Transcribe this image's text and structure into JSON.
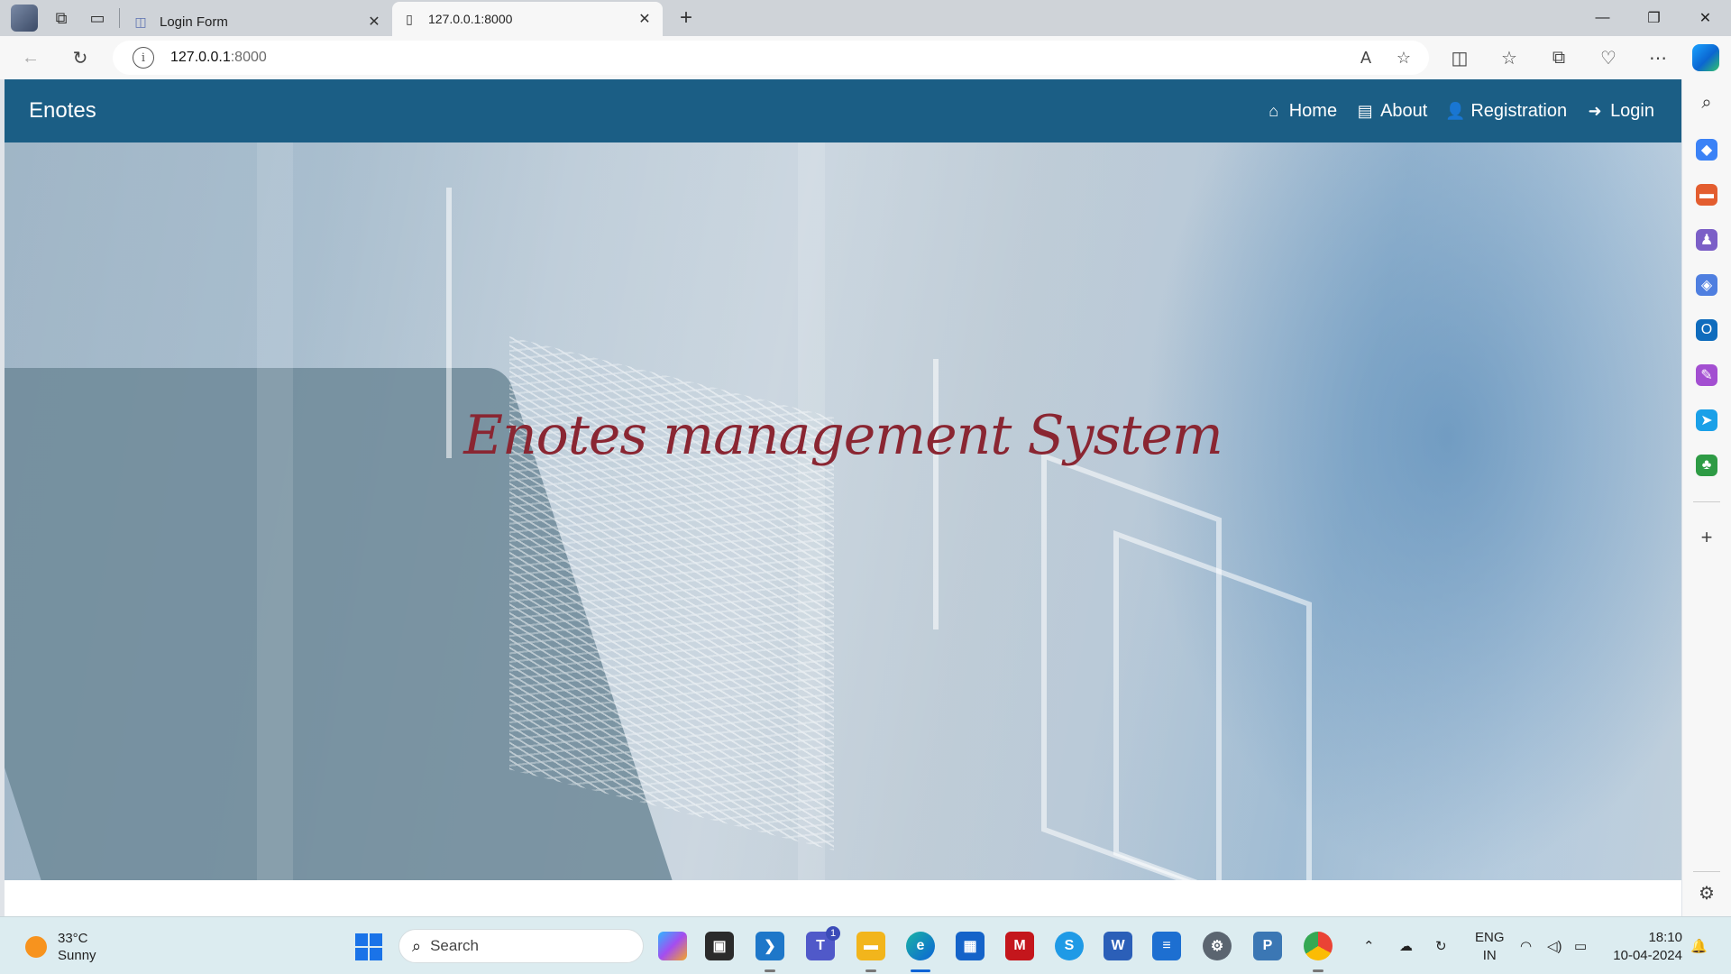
{
  "browser": {
    "tabs": [
      {
        "title": "Login Form",
        "active": false
      },
      {
        "title": "127.0.0.1:8000",
        "active": true
      }
    ],
    "address": {
      "host": "127.0.0.1",
      "port": ":8000"
    }
  },
  "site": {
    "brand": "Enotes",
    "menu": [
      {
        "label": "Home",
        "icon": "home-icon"
      },
      {
        "label": "About",
        "icon": "id-card-icon"
      },
      {
        "label": "Registration",
        "icon": "user-plus-icon"
      },
      {
        "label": "Login",
        "icon": "sign-in-icon"
      }
    ],
    "hero_title": "Enotes management System",
    "colors": {
      "navbar": "#1b5e85",
      "headline": "#8a2632"
    }
  },
  "taskbar": {
    "weather": {
      "temp": "33°C",
      "condition": "Sunny"
    },
    "search_placeholder": "Search",
    "teams_badge": "1",
    "language": {
      "line1": "ENG",
      "line2": "IN"
    },
    "clock": {
      "time": "18:10",
      "date": "10-04-2024"
    }
  }
}
